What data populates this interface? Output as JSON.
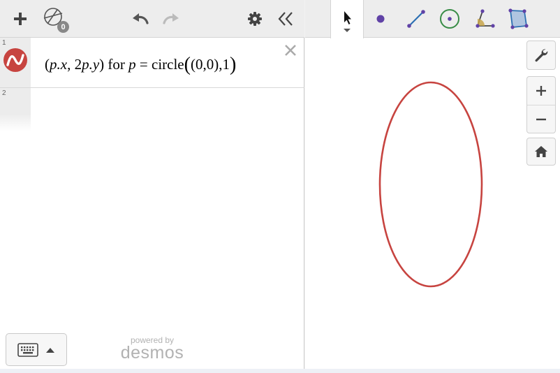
{
  "toolbar": {
    "add_icon": "plus-icon",
    "shapes_icon": "geometry-shapes-icon",
    "shapes_count": "0",
    "undo_icon": "undo-arrow-icon",
    "redo_icon": "redo-arrow-icon",
    "settings_icon": "gear-icon",
    "collapse_icon": "double-chevron-left-icon"
  },
  "expressions": [
    {
      "index": "1",
      "parts": {
        "open": "(",
        "px": "p.x",
        "sep": ", ",
        "coef": "2",
        "py": "p.y",
        "close": ")",
        "for": " for ",
        "var": "p",
        "eq": " = ",
        "fn": "circle",
        "lp": "(",
        "pt": "(0,0)",
        "comma": ",",
        "r": "1",
        "rp": ")"
      }
    },
    {
      "index": "2"
    }
  ],
  "footer": {
    "powered_by": "powered by",
    "brand": "desmos"
  },
  "geometry_tools": [
    "pointer-tool",
    "point-tool",
    "segment-tool",
    "circle-tool",
    "angle-tool",
    "polygon-tool"
  ],
  "graph_controls": [
    "wrench-icon",
    "zoom-in-icon",
    "zoom-out-icon",
    "home-icon"
  ],
  "colors": {
    "curve": "#c74440",
    "point": "#6042a6",
    "segment": "#2d70b3",
    "circle": "#388c46",
    "polygon": "#2d70b3"
  },
  "chart_data": {
    "type": "line",
    "series": [
      {
        "shape": "ellipse",
        "center": [
          0,
          0
        ],
        "rx": 1,
        "ry": 2,
        "color": "#c74440"
      }
    ]
  }
}
